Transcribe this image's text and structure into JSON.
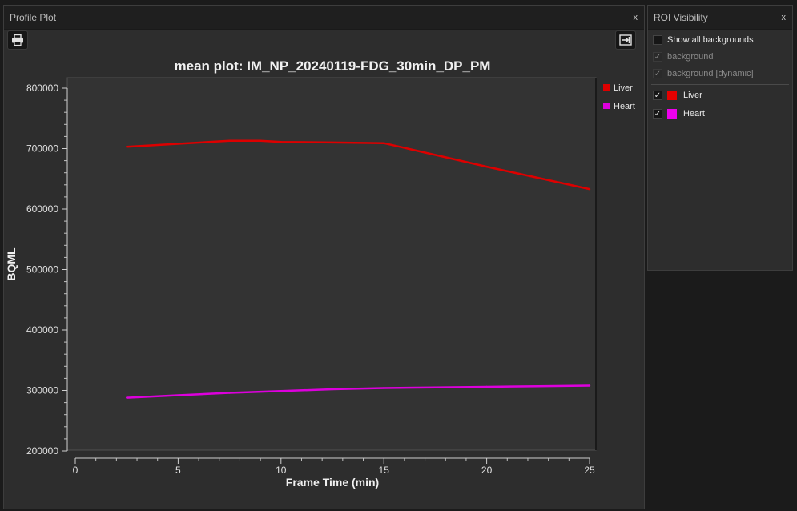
{
  "profile_panel": {
    "title": "Profile Plot",
    "close_label": "x"
  },
  "roi_panel": {
    "title": "ROI Visibility",
    "close_label": "x",
    "show_all_label": "Show all backgrounds",
    "items": [
      {
        "label": "background",
        "checked": true,
        "enabled": false
      },
      {
        "label": "background [dynamic]",
        "checked": true,
        "enabled": false
      },
      {
        "label": "Liver",
        "checked": true,
        "enabled": true,
        "color": "#e40000"
      },
      {
        "label": "Heart",
        "checked": true,
        "enabled": true,
        "color": "#ee00ee"
      }
    ]
  },
  "icons": {
    "print": "printer-icon",
    "export": "export-icon"
  },
  "chart_data": {
    "type": "line",
    "title": "mean plot: IM_NP_20240119-FDG_30min_DP_PM",
    "xlabel": "Frame Time (min)",
    "ylabel": "BQML",
    "xlim": [
      0,
      25
    ],
    "ylim": [
      200000,
      800000
    ],
    "x_ticks": [
      0,
      5,
      10,
      15,
      20,
      25
    ],
    "y_ticks": [
      200000,
      300000,
      400000,
      500000,
      600000,
      700000,
      800000
    ],
    "grid": false,
    "legend_position": "top-right",
    "series": [
      {
        "name": "Liver",
        "color": "#dd0000",
        "x": [
          2.5,
          5,
          7.5,
          9,
          10,
          12.5,
          15,
          20,
          25
        ],
        "y": [
          703000,
          708000,
          713000,
          713000,
          711000,
          710000,
          709000,
          670000,
          633000
        ]
      },
      {
        "name": "Heart",
        "color": "#dd00dd",
        "x": [
          2.5,
          5,
          7.5,
          10,
          12.5,
          15,
          17.5,
          20,
          22.5,
          25
        ],
        "y": [
          288000,
          292000,
          296000,
          299000,
          302000,
          304000,
          305000,
          306000,
          307000,
          308000
        ]
      }
    ]
  }
}
